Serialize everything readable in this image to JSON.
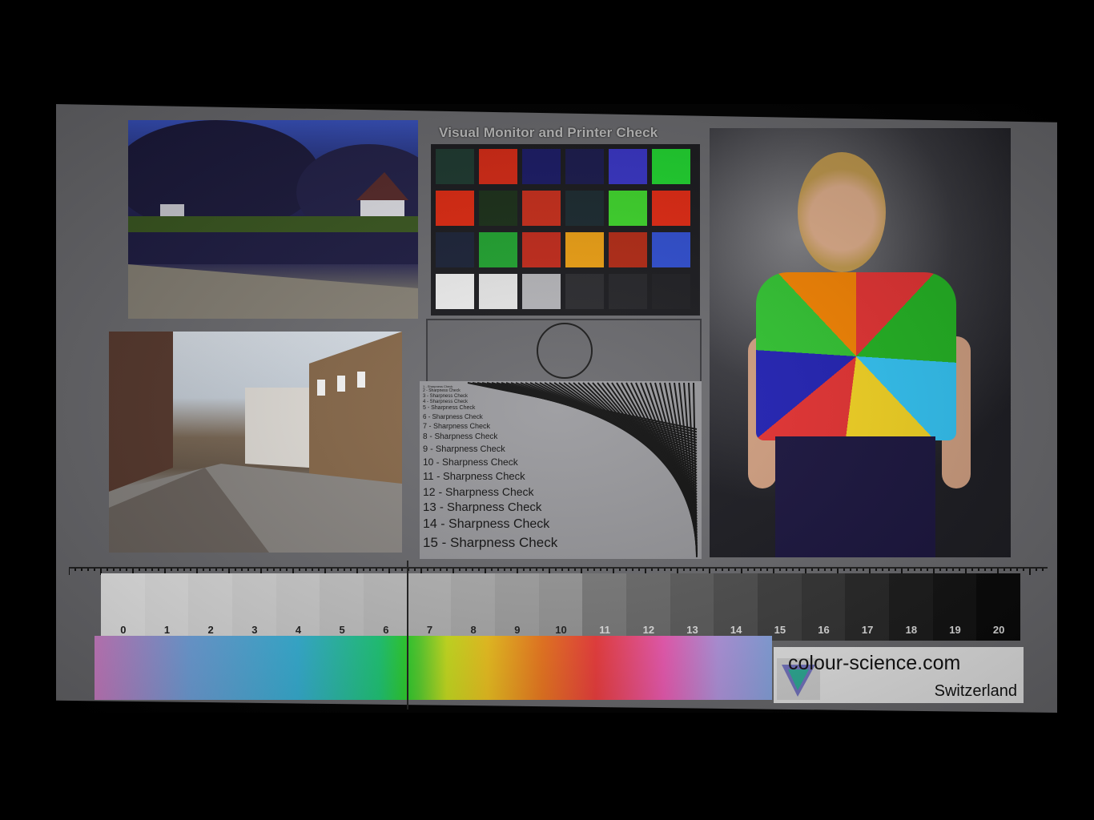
{
  "chart": {
    "title": "Visual Monitor and Printer Check",
    "swatch_colors": [
      [
        "#1d3a30",
        "#e02a14",
        "#1a1a6a",
        "#1a1a50",
        "#3a36d0",
        "#20e030"
      ],
      [
        "#e82a10",
        "#1a3018",
        "#d02e1a",
        "#1a2a30",
        "#40e02c",
        "#ec2a12"
      ],
      [
        "#1a2238",
        "#20a830",
        "#c82a1a",
        "#f4a412",
        "#b82a14",
        "#3050d8"
      ],
      [
        "#f4f4f4",
        "#ececec",
        "#b8b8bc",
        "#2a2a2e",
        "#242428",
        "#1e1e22"
      ]
    ],
    "sharpness_items": [
      {
        "label": "1 - Sharpness Check",
        "size": 4
      },
      {
        "label": "2 - Sharpness Check",
        "size": 5
      },
      {
        "label": "3 - Sharpness Check",
        "size": 6
      },
      {
        "label": "4 - Sharpness Check",
        "size": 6
      },
      {
        "label": "5 - Sharpness Check",
        "size": 7
      },
      {
        "label": "6 - Sharpness Check",
        "size": 8
      },
      {
        "label": "7 - Sharpness Check",
        "size": 9
      },
      {
        "label": "8 - Sharpness Check",
        "size": 10
      },
      {
        "label": "9 - Sharpness Check",
        "size": 11
      },
      {
        "label": "10 - Sharpness Check",
        "size": 12
      },
      {
        "label": "11 - Sharpness Check",
        "size": 13
      },
      {
        "label": "12 - Sharpness Check",
        "size": 14
      },
      {
        "label": "13 - Sharpness Check",
        "size": 15
      },
      {
        "label": "14 - Sharpness Check",
        "size": 16
      },
      {
        "label": "15 - Sharpness Check",
        "size": 17
      }
    ]
  },
  "grayscale": {
    "steps": [
      "0",
      "1",
      "2",
      "3",
      "4",
      "5",
      "6",
      "7",
      "8",
      "9",
      "10",
      "11",
      "12",
      "13",
      "14",
      "15",
      "16",
      "17",
      "18",
      "19",
      "20"
    ],
    "levels": [
      0.97,
      0.94,
      0.91,
      0.88,
      0.85,
      0.81,
      0.78,
      0.74,
      0.7,
      0.66,
      0.62,
      0.5,
      0.44,
      0.38,
      0.32,
      0.26,
      0.21,
      0.16,
      0.11,
      0.07,
      0.03
    ]
  },
  "logo": {
    "name": "colour-science.com",
    "country": "Switzerland"
  }
}
